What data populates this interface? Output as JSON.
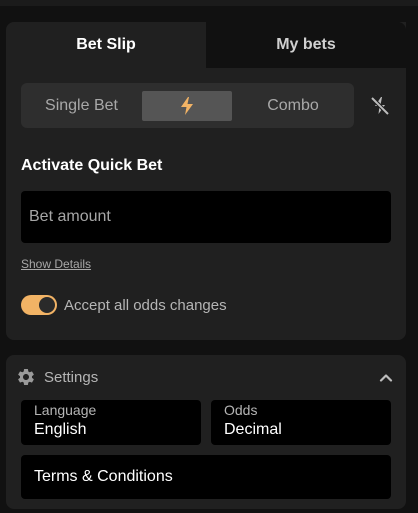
{
  "tabs": {
    "bet_slip": "Bet Slip",
    "my_bets": "My bets"
  },
  "bet_type": {
    "single": "Single Bet",
    "quick_icon": "lightning-bolt-icon",
    "combo": "Combo",
    "quick_off_icon": "lightning-off-icon"
  },
  "quick_bet": {
    "title": "Activate Quick Bet",
    "amount_placeholder": "Bet amount",
    "amount_value": "",
    "show_details": "Show Details"
  },
  "odds_toggle": {
    "label": "Accept all odds changes",
    "checked": true
  },
  "settings": {
    "title": "Settings",
    "gear_icon": "gear-icon",
    "collapse_icon": "chevron-up-icon",
    "language": {
      "label": "Language",
      "value": "English"
    },
    "odds": {
      "label": "Odds",
      "value": "Decimal"
    },
    "terms": "Terms & Conditions"
  },
  "colors": {
    "background": "#111111",
    "card": "#202020",
    "segment": "#2e2e2e",
    "segment_active": "#555555",
    "accent": "#f2b365",
    "input": "#000000"
  }
}
